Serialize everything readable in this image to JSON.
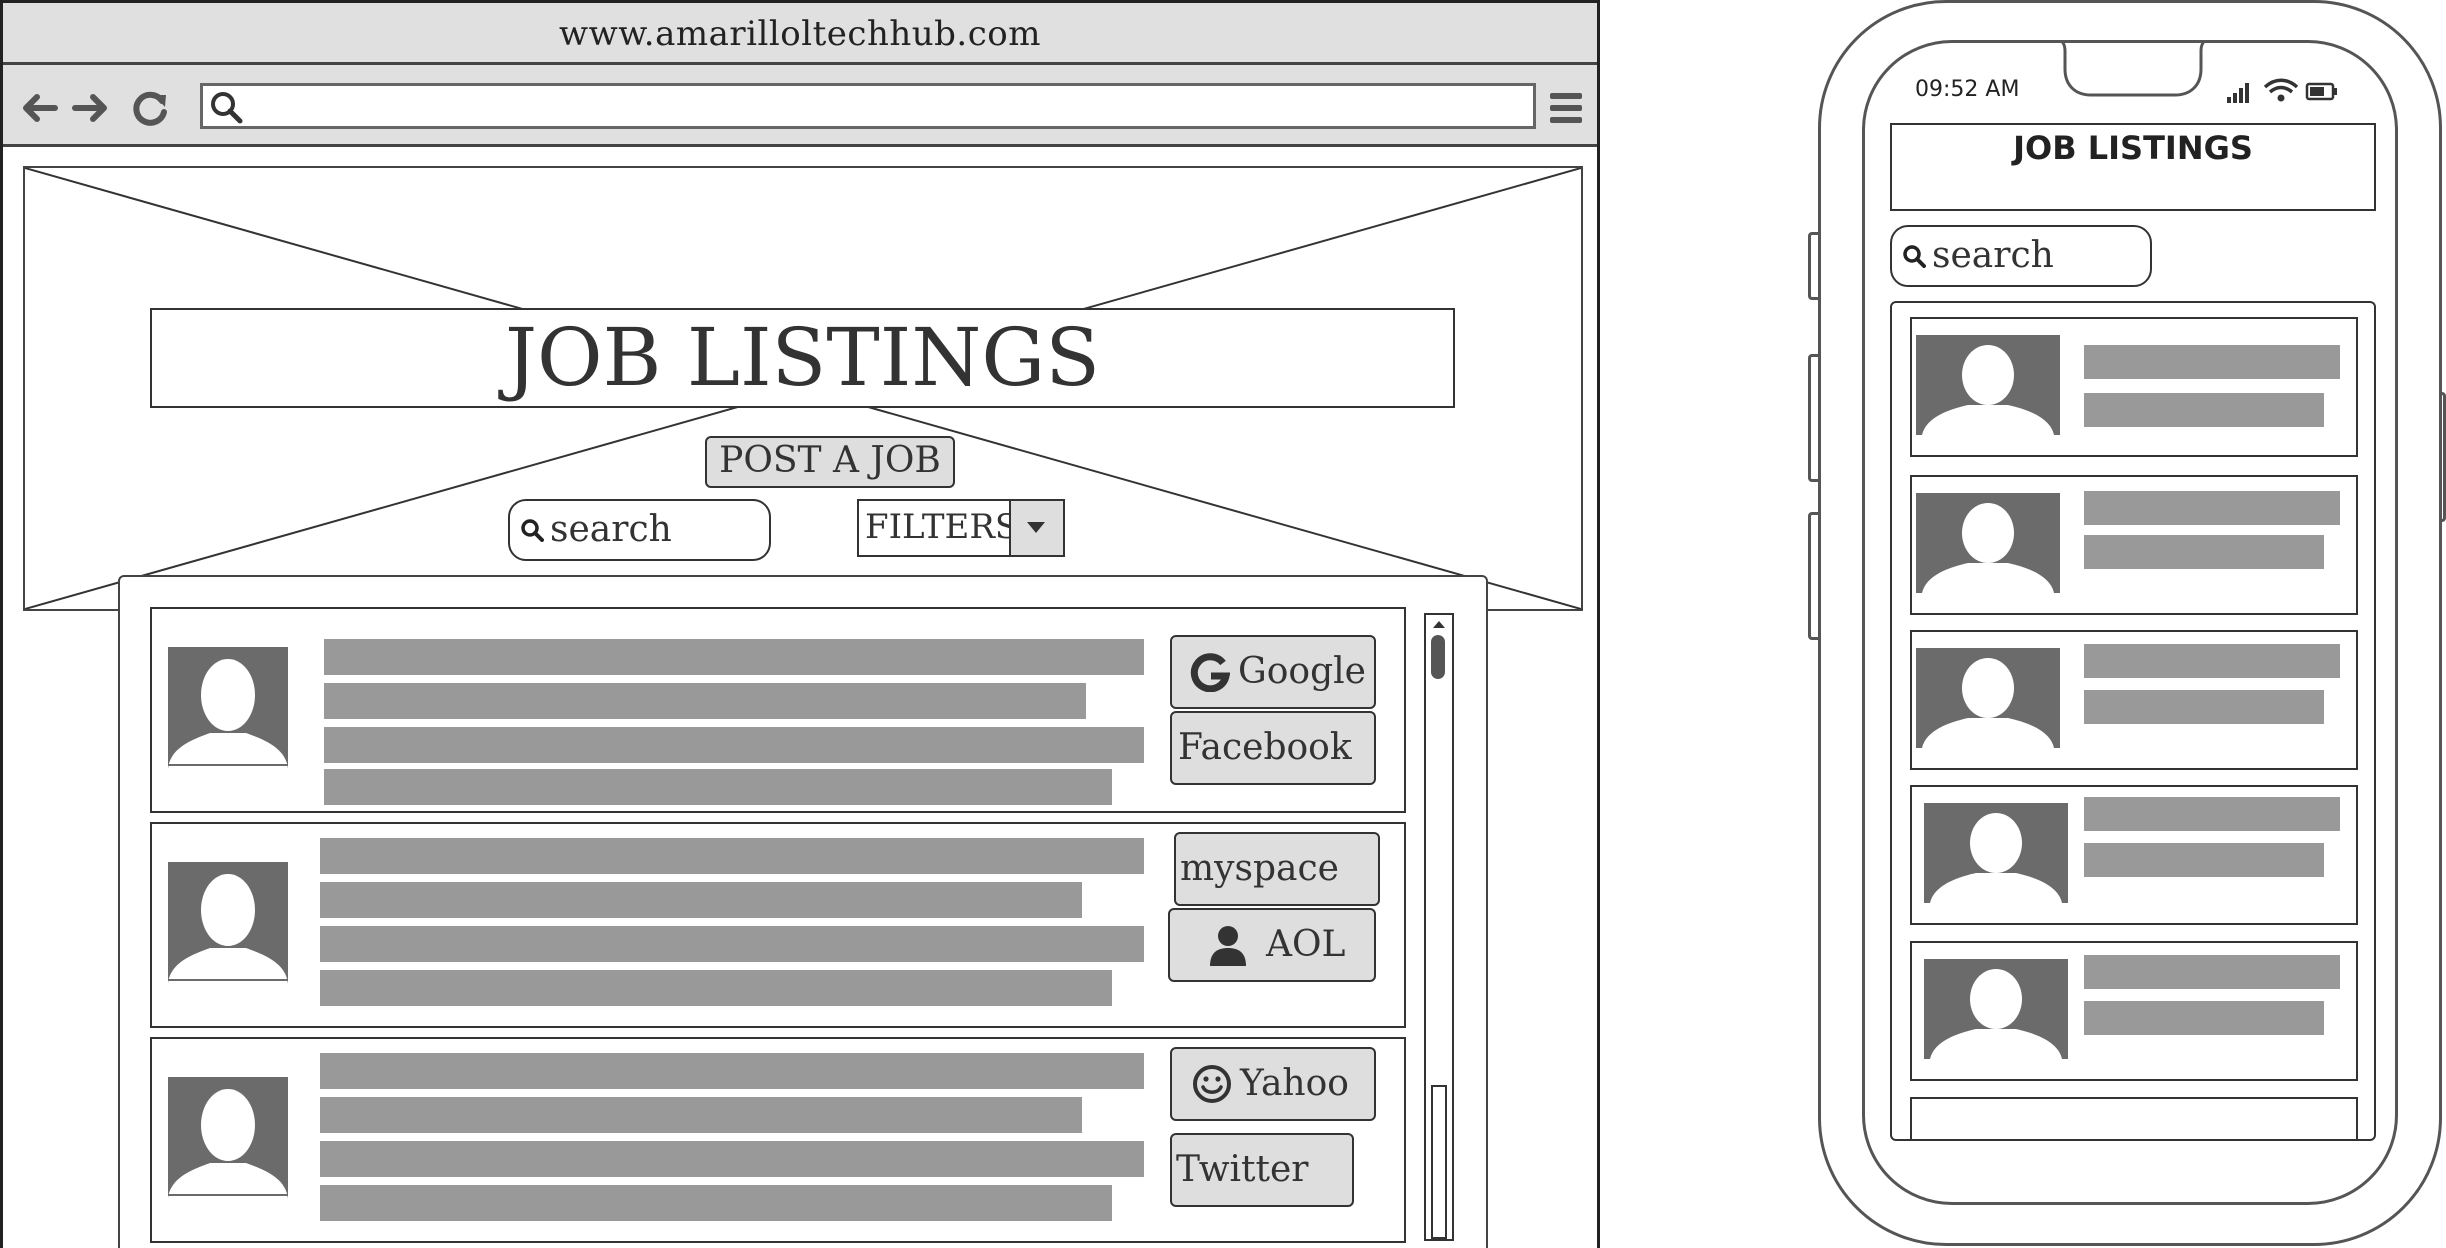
{
  "browser": {
    "url": "www.amarilloltechhub.com",
    "icons": [
      "back-arrow-icon",
      "forward-arrow-icon",
      "reload-icon",
      "search-icon",
      "hamburger-menu-icon"
    ]
  },
  "page": {
    "title": "JOB LISTINGS",
    "post_job_label": "POST A JOB",
    "search_placeholder": "search",
    "filters_label": "FILTERS"
  },
  "listings": [
    {
      "buttons": [
        {
          "label": "Google",
          "icon": "google-icon"
        },
        {
          "label": "Facebook",
          "icon": null
        }
      ]
    },
    {
      "buttons": [
        {
          "label": "myspace",
          "icon": null
        },
        {
          "label": "AOL",
          "icon": "user-icon"
        }
      ]
    },
    {
      "buttons": [
        {
          "label": "Yahoo",
          "icon": "smiley-icon"
        },
        {
          "label": "Twitter",
          "icon": null
        }
      ]
    }
  ],
  "mobile": {
    "time": "09:52 AM",
    "status_icons": [
      "signal-icon",
      "wifi-icon",
      "battery-icon"
    ],
    "title": "JOB LISTINGS",
    "search_placeholder": "search",
    "listing_count": 5
  },
  "colors": {
    "chrome": "#e0e0e0",
    "placeholder_bar": "#999999",
    "avatar": "#6b6b6b",
    "button": "#dedede",
    "border": "#333333"
  }
}
